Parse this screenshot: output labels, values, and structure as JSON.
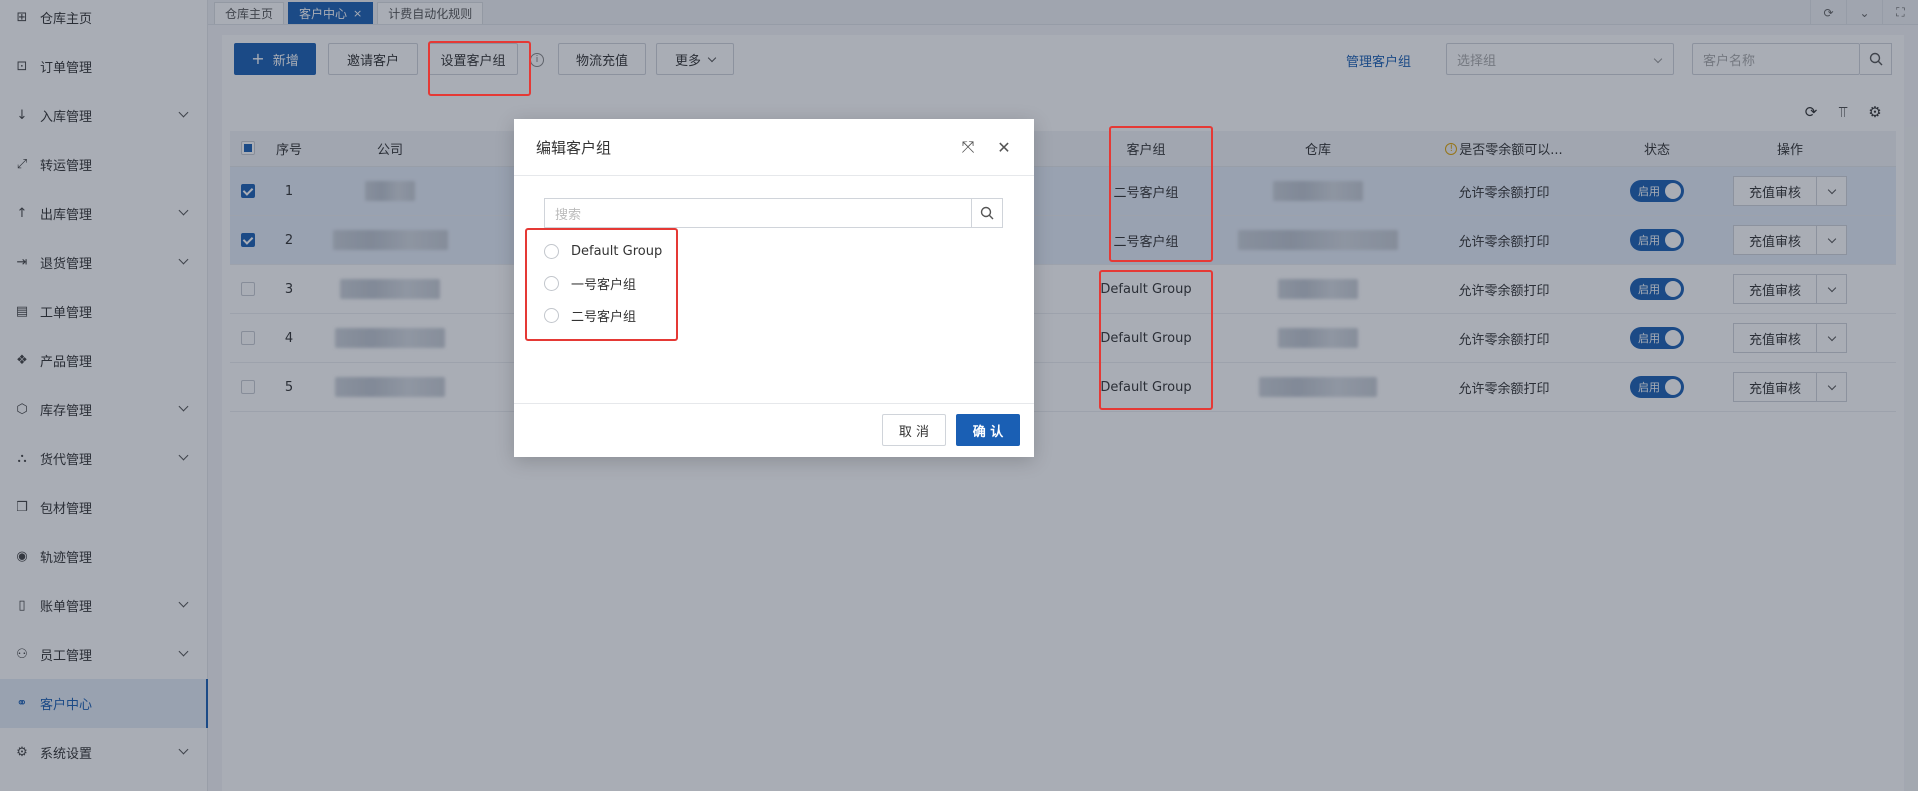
{
  "sidebar": {
    "items": [
      {
        "label": "仓库主页",
        "icon": "grid-icon",
        "glyph": "⊞",
        "expandable": false,
        "active": false
      },
      {
        "label": "订单管理",
        "icon": "order-icon",
        "glyph": "⊡",
        "expandable": false,
        "active": false
      },
      {
        "label": "入库管理",
        "icon": "inbound-icon",
        "glyph": "↓",
        "expandable": true,
        "active": false
      },
      {
        "label": "转运管理",
        "icon": "transfer-icon",
        "glyph": "⤢",
        "expandable": false,
        "active": false
      },
      {
        "label": "出库管理",
        "icon": "outbound-icon",
        "glyph": "↑",
        "expandable": true,
        "active": false
      },
      {
        "label": "退货管理",
        "icon": "return-icon",
        "glyph": "⇥",
        "expandable": true,
        "active": false
      },
      {
        "label": "工单管理",
        "icon": "ticket-icon",
        "glyph": "▤",
        "expandable": false,
        "active": false
      },
      {
        "label": "产品管理",
        "icon": "product-icon",
        "glyph": "❖",
        "expandable": false,
        "active": false
      },
      {
        "label": "库存管理",
        "icon": "inventory-icon",
        "glyph": "⬡",
        "expandable": true,
        "active": false
      },
      {
        "label": "货代管理",
        "icon": "forwarder-icon",
        "glyph": "⛬",
        "expandable": true,
        "active": false
      },
      {
        "label": "包材管理",
        "icon": "package-icon",
        "glyph": "❒",
        "expandable": false,
        "active": false
      },
      {
        "label": "轨迹管理",
        "icon": "track-icon",
        "glyph": "◉",
        "expandable": false,
        "active": false
      },
      {
        "label": "账单管理",
        "icon": "bill-icon",
        "glyph": "▯",
        "expandable": true,
        "active": false
      },
      {
        "label": "员工管理",
        "icon": "staff-icon",
        "glyph": "⚇",
        "expandable": true,
        "active": false
      },
      {
        "label": "客户中心",
        "icon": "customer-icon",
        "glyph": "⚭",
        "expandable": false,
        "active": true
      },
      {
        "label": "系统设置",
        "icon": "settings-icon",
        "glyph": "⚙",
        "expandable": true,
        "active": false
      }
    ]
  },
  "tabs": [
    {
      "label": "仓库主页",
      "active": false,
      "closable": false
    },
    {
      "label": "客户中心",
      "active": true,
      "closable": true
    },
    {
      "label": "计费自动化规则",
      "active": false,
      "closable": false
    }
  ],
  "tab_close_glyph": "×",
  "toolbar": {
    "new_label": "新增",
    "invite_label": "邀请客户",
    "set_group_label": "设置客户组",
    "info_glyph": "i",
    "logistics_recharge_label": "物流充值",
    "more_label": "更多",
    "manage_group_label": "管理客户组",
    "group_select_placeholder": "选择组",
    "customer_name_placeholder": "客户名称"
  },
  "table": {
    "headers": {
      "index": "序号",
      "company": "公司",
      "group": "客户组",
      "warehouse": "仓库",
      "allow_zero": "是否零余额可以...",
      "status": "状态",
      "action": "操作"
    },
    "rows": [
      {
        "index": "1",
        "checked": true,
        "group": "二号客户组",
        "allow": "允许零余额打印",
        "status": "启用",
        "action": "充值审核"
      },
      {
        "index": "2",
        "checked": true,
        "group": "二号客户组",
        "allow": "允许零余额打印",
        "status": "启用",
        "action": "充值审核"
      },
      {
        "index": "3",
        "checked": false,
        "group": "Default Group",
        "allow": "允许零余额打印",
        "status": "启用",
        "action": "充值审核"
      },
      {
        "index": "4",
        "checked": false,
        "group": "Default Group",
        "allow": "允许零余额打印",
        "status": "启用",
        "action": "充值审核"
      },
      {
        "index": "5",
        "checked": false,
        "group": "Default Group",
        "allow": "允许零余额打印",
        "status": "启用",
        "action": "充值审核"
      }
    ]
  },
  "modal": {
    "title": "编辑客户组",
    "search_placeholder": "搜索",
    "options": [
      "Default Group",
      "一号客户组",
      "二号客户组"
    ],
    "cancel_label": "取 消",
    "confirm_label": "确 认"
  },
  "colors": {
    "primary": "#1a5fb4",
    "highlight": "#e53935",
    "selected_row": "#e5edf8"
  }
}
